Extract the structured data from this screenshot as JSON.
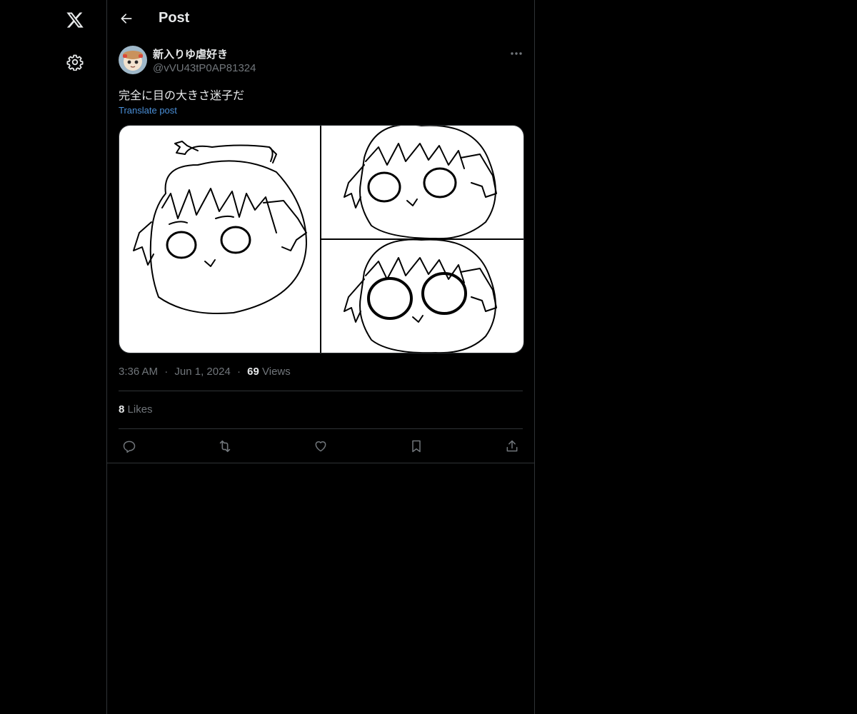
{
  "nav": {
    "logo_icon": "x-logo-icon",
    "settings_icon": "gear-icon"
  },
  "header": {
    "back_icon": "arrow-left-icon",
    "title": "Post"
  },
  "post": {
    "display_name": "新入りゆ虐好き",
    "handle": "@vVU43tP0AP81324",
    "more_icon": "ellipsis-icon",
    "text": "完全に目の大きさ迷子だ",
    "translate_label": "Translate post",
    "media_count": 3,
    "time": "3:36 AM",
    "separator": "·",
    "date": "Jun 1, 2024",
    "views_count": "69",
    "views_label": "Views",
    "likes_count": "8",
    "likes_label": "Likes"
  },
  "actions": [
    {
      "name": "reply",
      "icon": "reply-icon"
    },
    {
      "name": "repost",
      "icon": "repost-icon"
    },
    {
      "name": "like",
      "icon": "heart-icon"
    },
    {
      "name": "bookmark",
      "icon": "bookmark-icon"
    },
    {
      "name": "share",
      "icon": "share-icon"
    }
  ],
  "colors": {
    "background": "#000000",
    "text_primary": "#e7e9ea",
    "text_secondary": "#71767b",
    "link": "#4a8fd8",
    "border": "#2f3336"
  }
}
